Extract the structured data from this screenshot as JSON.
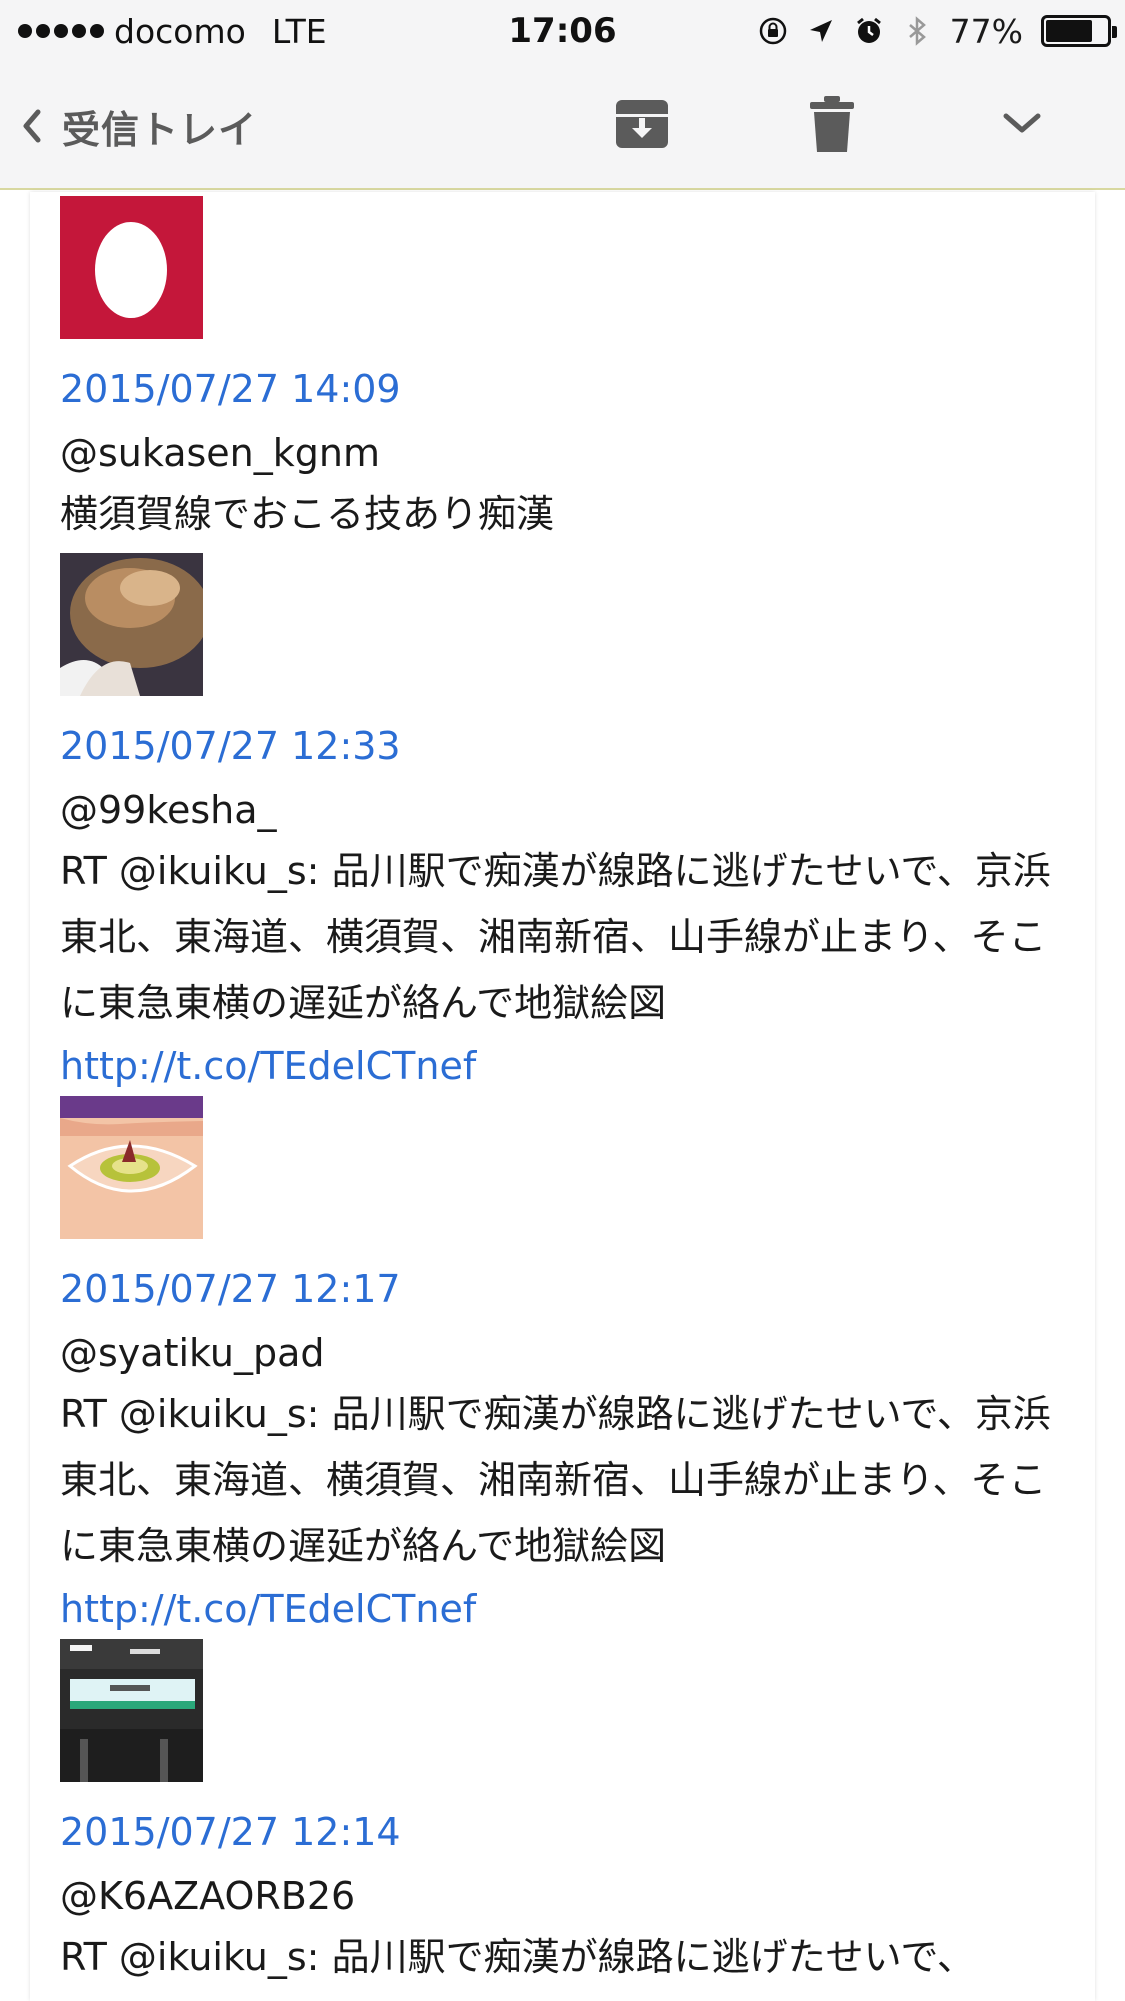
{
  "status_bar": {
    "carrier": "docomo",
    "network": "LTE",
    "time": "17:06",
    "battery": "77%",
    "battery_level": 0.77,
    "icons": [
      "orientation-lock-icon",
      "location-arrow-icon",
      "alarm-icon",
      "bluetooth-icon"
    ]
  },
  "nav": {
    "back_label": "受信トレイ",
    "icons": [
      "back-chevron-icon",
      "archive-icon",
      "trash-icon",
      "chevron-down-icon"
    ]
  },
  "tweets": [
    {
      "avatar": "egg-avatar",
      "date": "2015/07/27 14:09",
      "user": "@sukasen_kgnm",
      "text": "横須賀線でおこる技あり痴漢",
      "link": ""
    },
    {
      "avatar": "hair-photo-avatar",
      "date": "2015/07/27 12:33",
      "user": "@99kesha_",
      "text": "RT @ikuiku_s: 品川駅で痴漢が線路に逃げたせいで、京浜東北、東海道、横須賀、湘南新宿、山手線が止まり、そこに東急東横の遅延が絡んで地獄絵図",
      "link": "http://t.co/TEdelCTnef"
    },
    {
      "avatar": "dessert-photo-avatar",
      "date": "2015/07/27 12:17",
      "user": "@syatiku_pad",
      "text": "RT @ikuiku_s: 品川駅で痴漢が線路に逃げたせいで、京浜東北、東海道、横須賀、湘南新宿、山手線が止まり、そこに東急東横の遅延が絡んで地獄絵図",
      "link": "http://t.co/TEdelCTnef"
    },
    {
      "avatar": "station-sign-avatar",
      "date": "2015/07/27 12:14",
      "user": "@K6AZAORB26",
      "text": "RT @ikuiku_s: 品川駅で痴漢が線路に逃げたせいで、",
      "link": ""
    }
  ]
}
